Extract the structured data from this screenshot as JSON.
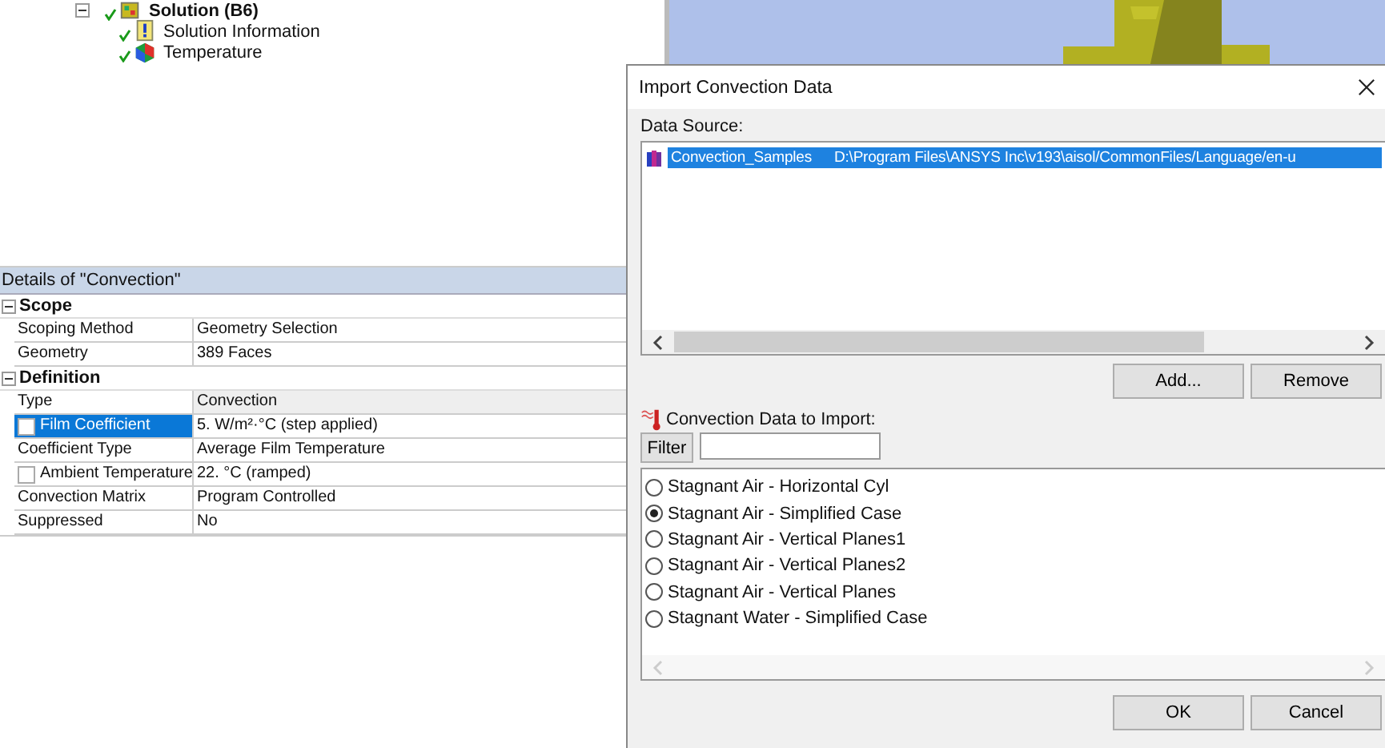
{
  "tree": {
    "items": [
      {
        "label": "Solution (B6)",
        "kind": "solution",
        "expanded": true,
        "children": [
          {
            "label": "Solution Information",
            "kind": "info"
          },
          {
            "label": "Temperature",
            "kind": "result"
          }
        ]
      }
    ]
  },
  "details": {
    "title": "Details of \"Convection\"",
    "groups": [
      {
        "label": "Scope",
        "expanded": true,
        "rows": [
          {
            "label": "Scoping Method",
            "value": "Geometry Selection",
            "selected": false
          },
          {
            "label": "Geometry",
            "value": "389 Faces",
            "selected": false
          }
        ]
      },
      {
        "label": "Definition",
        "expanded": true,
        "rows": [
          {
            "label": "Type",
            "value": "Convection",
            "selected": false,
            "read_only": true
          },
          {
            "label": "Film Coefficient",
            "value": "5. W/m²·°C  (step applied)",
            "selected": true,
            "checked": false
          },
          {
            "label": "Coefficient Type",
            "value": "Average Film Temperature",
            "selected": false
          },
          {
            "label": "Ambient Temperature",
            "value": "22. °C  (ramped)",
            "selected": false,
            "checked": false
          },
          {
            "label": "Convection Matrix",
            "value": "Program Controlled",
            "selected": false
          },
          {
            "label": "Suppressed",
            "value": "No",
            "selected": false
          }
        ]
      }
    ]
  },
  "dialog": {
    "title": "Import Convection Data",
    "data_source_label": "Data Source:",
    "sources": [
      {
        "name": "Convection_Samples",
        "path": "D:\\Program Files\\ANSYS Inc\\v193\\aisol/CommonFiles/Language/en-u",
        "selected": true
      }
    ],
    "source_buttons": [
      "Add...",
      "Remove"
    ],
    "import_label": "Convection Data to Import:",
    "filter_button": "Filter",
    "options": [
      {
        "label": "Stagnant Air - Horizontal Cyl",
        "selected": false
      },
      {
        "label": "Stagnant Air - Simplified Case",
        "selected": true
      },
      {
        "label": "Stagnant Air - Vertical Planes1",
        "selected": false
      },
      {
        "label": "Stagnant Air - Vertical Planes2",
        "selected": false
      },
      {
        "label": "Stagnant Air - Vertical Planes",
        "selected": false
      },
      {
        "label": "Stagnant Water - Simplified Case",
        "selected": false
      }
    ],
    "buttons": [
      "OK",
      "Cancel"
    ]
  }
}
